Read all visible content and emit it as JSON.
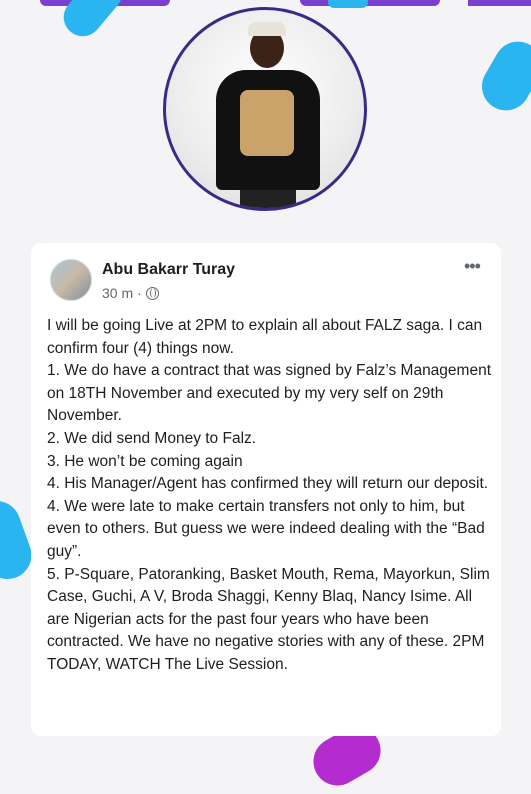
{
  "post": {
    "author": "Abu Bakarr Turay",
    "timestamp": "30 m",
    "separator": "·",
    "privacy_icon": "globe-icon",
    "more_icon": "more-options-icon",
    "lines": [
      "I will be going Live at 2PM to explain all about FALZ saga. I can confirm four (4) things now.",
      "1. We do have a contract that was signed by Falz’s Management on 18TH November and executed by my very self on 29th November.",
      "2. We did send Money to Falz.",
      "3. He won’t be coming again",
      "4. His Manager/Agent has confirmed they will return our deposit.",
      "4. We were late to make certain transfers not only to him, but even to others. But guess we were indeed dealing with the “Bad guy”.",
      "5. P-Square, Patoranking, Basket Mouth, Rema, Mayorkun, Slim Case, Guchi, A V, Broda Shaggi, Kenny Blaq, Nancy Isime. All are Nigerian acts for the past four years who have been contracted. We have no negative stories with any of these. 2PM TODAY, WATCH The Live Session."
    ]
  },
  "colors": {
    "accent_purple": "#7b3fd0",
    "accent_blue": "#2bb5f0",
    "accent_magenta": "#b42bd0",
    "text_primary": "#1c1e21",
    "text_secondary": "#65676b"
  }
}
